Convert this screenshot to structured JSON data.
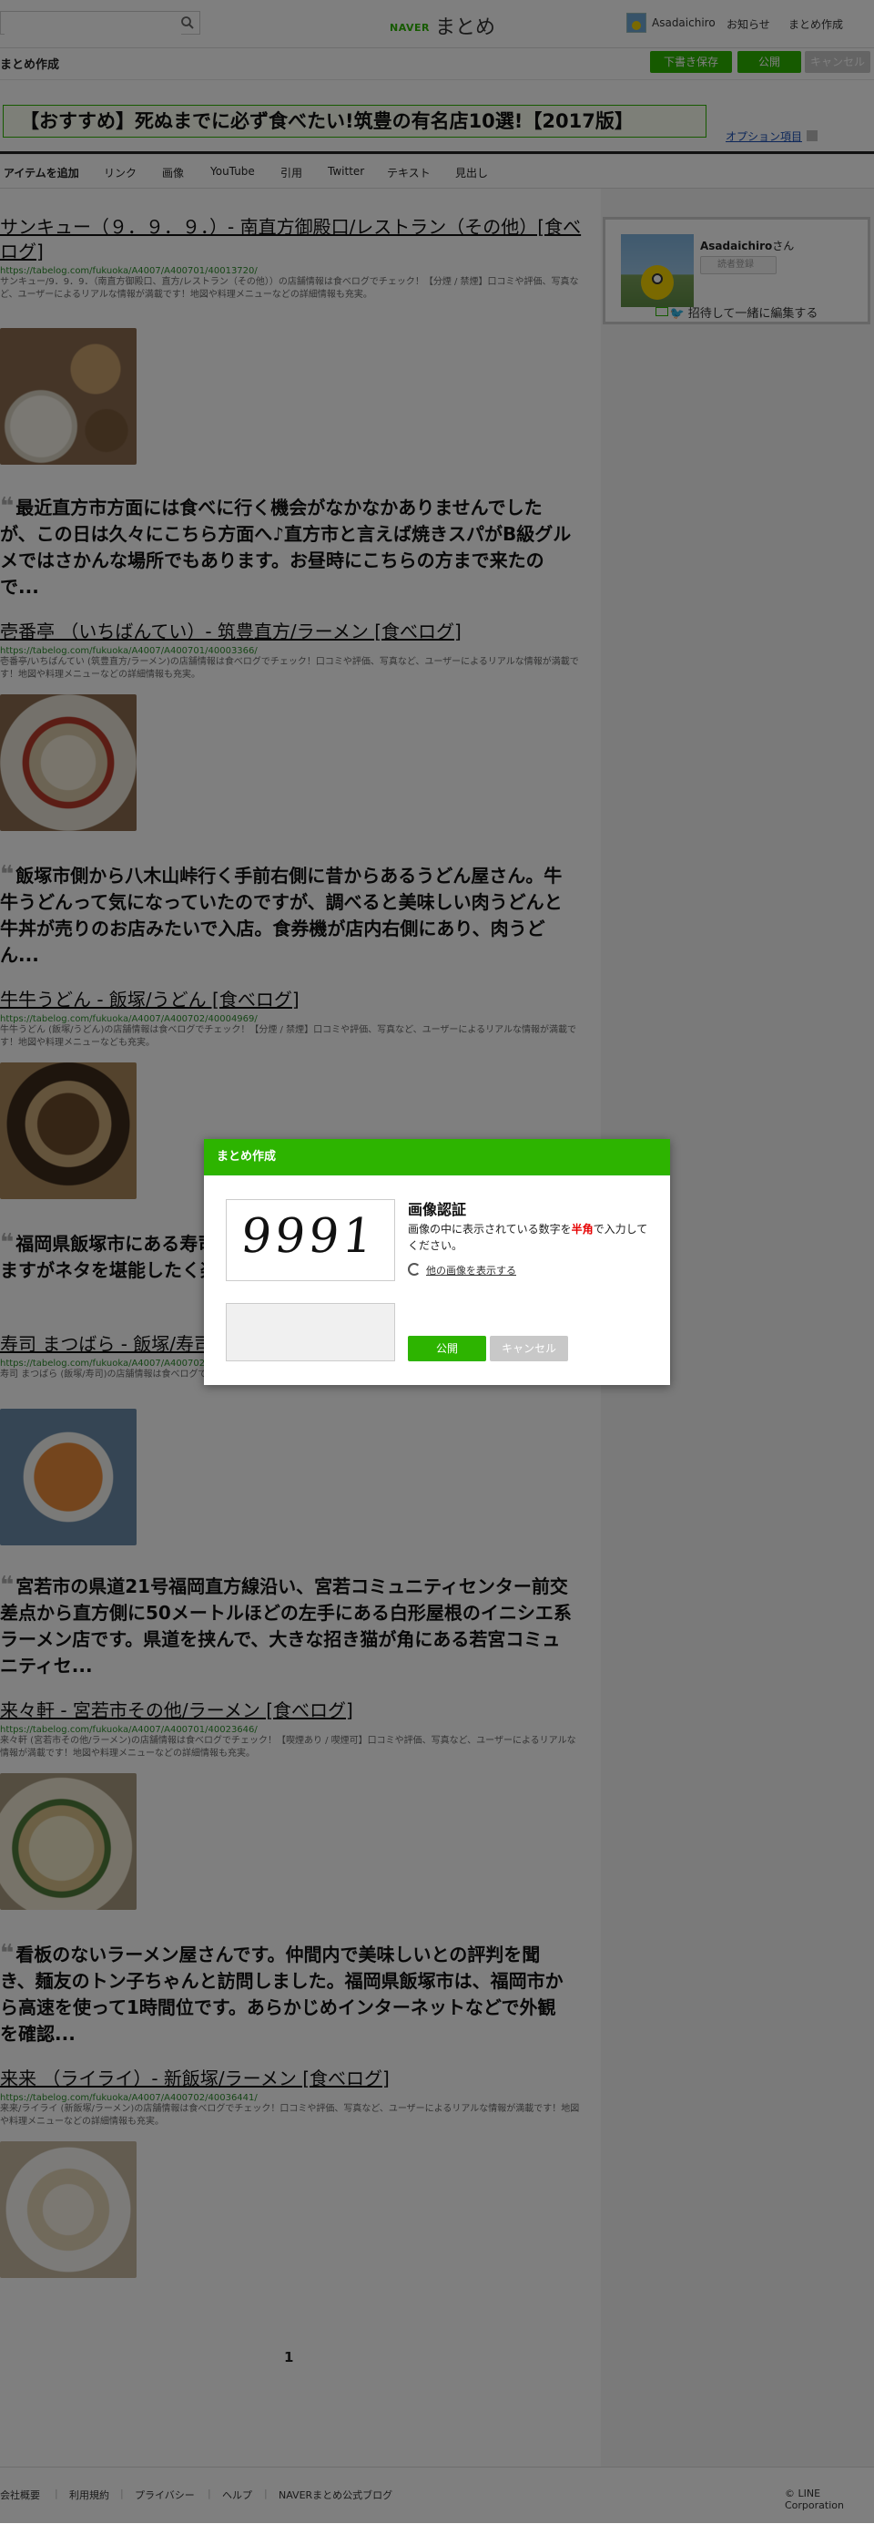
{
  "header": {
    "search_placeholder": "",
    "logo_naver": "NAVER",
    "logo_matome": "まとめ",
    "user_name": "Asadaichiro",
    "notice": "お知らせ",
    "create": "まとめ作成"
  },
  "toolbar": {
    "title": "まとめ作成",
    "draft_save": "下書き保存",
    "publish": "公開",
    "cancel": "キャンセル"
  },
  "title_area": {
    "title": "【おすすめ】死ぬまでに必ず食べたい!筑豊の有名店10選!【2017版】",
    "option": "オプション項目"
  },
  "add_tabs": [
    "アイテムを追加",
    "リンク",
    "画像",
    "YouTube",
    "引用",
    "Twitter",
    "テキスト",
    "見出し"
  ],
  "entries": [
    {
      "title": "サンキュー（９．９．９．）- 南直方御殿口/レストラン（その他）[食べログ]",
      "url": "https://tabelog.com/fukuoka/A4007/A400701/40013720/",
      "desc": "サンキュー/9．9．9．（南直方御殿口、直方/レストラン（その他））の店舗情報は食べログでチェック！【分煙 / 禁煙】口コミや評価、写真など、ユーザーによるリアルな情報が満載です！地図や料理メニューなどの詳細情報も充実。",
      "quote": "最近直方市方面には食べに行く機会がなかなかありませんでしたが、この日は久々にこちら方面へ♪直方市と言えば焼きスパがB級グルメではさかんな場所でもあります。お昼時にこちらの方まで来たので..."
    },
    {
      "title": "壱番亭 （いちばんてい）- 筑豊直方/ラーメン [食べログ]",
      "url": "https://tabelog.com/fukuoka/A4007/A400701/40003366/",
      "desc": "壱番亭/いちばんてい (筑豊直方/ラーメン)の店舗情報は食べログでチェック！口コミや評価、写真など、ユーザーによるリアルな情報が満載です！地図や料理メニューなどの詳細情報も充実。",
      "quote": "飯塚市側から八木山峠行く手前右側に昔からあるうどん屋さん。牛牛うどんって気になっていたのですが、調べると美味しい肉うどんと牛丼が売りのお店みたいで入店。食券機が店内右側にあり、肉うどん..."
    },
    {
      "title": "牛牛うどん - 飯塚/うどん [食べログ]",
      "url": "https://tabelog.com/fukuoka/A4007/A400702/40004969/",
      "desc": "牛牛うどん (飯塚/うどん)の店舗情報は食べログでチェック！【分煙 / 禁煙】口コミや評価、写真など、ユーザーによるリアルな情報が満載です！地図や料理メニューなども充実。",
      "quote": "福岡県飯塚市にある寿司屋さんです。ランチでお邪魔した事がありますがネタを堪能したく楽しみにしていました..."
    },
    {
      "title": "寿司 まつばら - 飯塚/寿司 [食べログ]",
      "url": "https://tabelog.com/fukuoka/A4007/A400702/40003113/",
      "desc": "寿司 まつばら (飯塚/寿司)の店舗情報は食べログでチェック！口コミや評価、写真など、ユーザーによるリアルな情報が満載です！",
      "quote": "宮若市の県道21号福岡直方線沿い、宮若コミュニティセンター前交差点から直方側に50メートルほどの左手にある白形屋根のイニシエ系ラーメン店です。県道を挟んで、大きな招き猫が角にある若宮コミュニティセ..."
    },
    {
      "title": "来々軒 - 宮若市その他/ラーメン [食べログ]",
      "url": "https://tabelog.com/fukuoka/A4007/A400701/40023646/",
      "desc": "来々軒 (宮若市その他/ラーメン)の店舗情報は食べログでチェック！【喫煙あり / 喫煙可】口コミや評価、写真など、ユーザーによるリアルな情報が満載です！地図や料理メニューなどの詳細情報も充実。",
      "quote": "看板のないラーメン屋さんです。仲間内で美味しいとの評判を聞き、麺友のトン子ちゃんと訪問しました。福岡県飯塚市は、福岡市から高速を使って1時間位です。あらかじめインターネットなどで外観を確認..."
    },
    {
      "title": "来来 （ライライ）- 新飯塚/ラーメン [食べログ]",
      "url": "https://tabelog.com/fukuoka/A4007/A400702/40036441/",
      "desc": "来来/ライライ (新飯塚/ラーメン)の店舗情報は食べログでチェック！口コミや評価、写真など、ユーザーによるリアルな情報が満載です！地図や料理メニューなどの詳細情報も充実。",
      "quote": ""
    }
  ],
  "pager": {
    "current": "1"
  },
  "sidebar": {
    "user_name": "Asadaichiro",
    "honorific": "さん",
    "follow": "読者登録",
    "invite": "招待して一緒に編集する"
  },
  "footer": {
    "links": [
      "会社概要",
      "利用規約",
      "プライバシー",
      "ヘルプ",
      "NAVERまとめ公式ブログ"
    ],
    "copyright": "© LINE Corporation"
  },
  "modal": {
    "header": "まとめ作成",
    "captcha_text": "9991",
    "title": "画像認証",
    "desc_before": "画像の中に表示されている数字を",
    "desc_highlight": "半角",
    "desc_after": "で入力してください。",
    "refresh": "他の画像を表示する",
    "input_value": "",
    "publish": "公開",
    "cancel": "キャンセル"
  },
  "colors": {
    "brand_green": "#2db400",
    "highlight_red": "#e60000",
    "cancel_gray": "#c8c8c8"
  }
}
